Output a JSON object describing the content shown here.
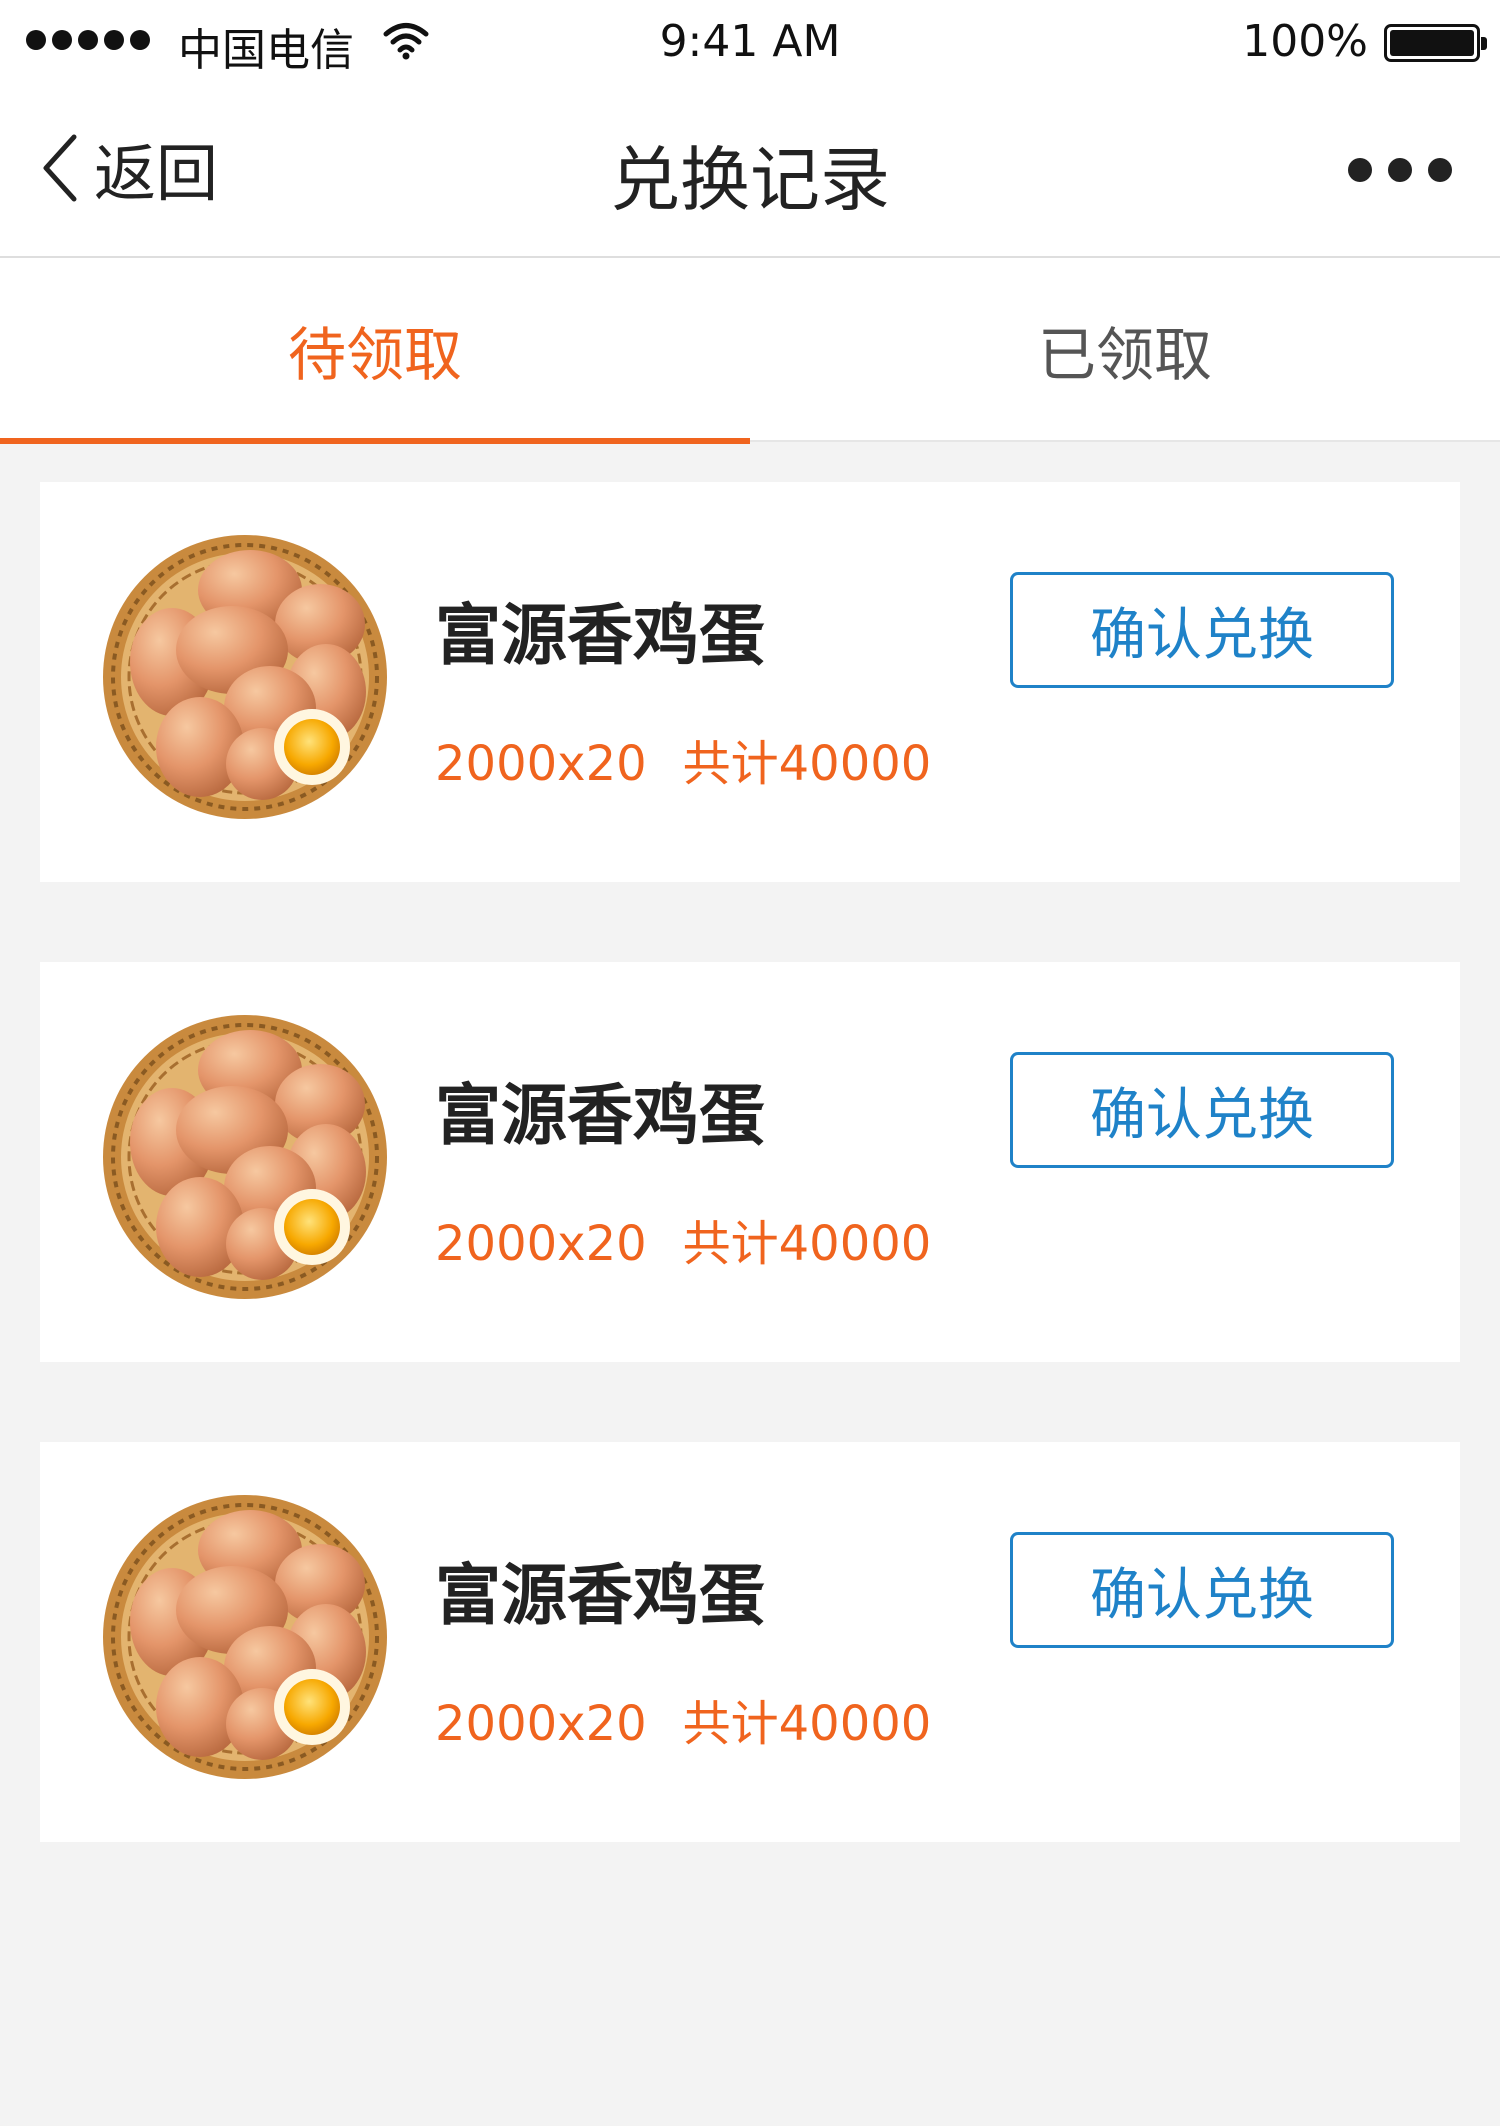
{
  "status_bar": {
    "carrier": "中国电信",
    "time": "9:41 AM",
    "battery": "100%"
  },
  "nav": {
    "back_label": "返回",
    "title": "兑换记录"
  },
  "tabs": [
    {
      "label": "待领取",
      "active": true
    },
    {
      "label": "已领取",
      "active": false
    }
  ],
  "items": [
    {
      "name": "富源香鸡蛋",
      "quantity": "2000x20",
      "total": "共计40000",
      "button": "确认兑换"
    },
    {
      "name": "富源香鸡蛋",
      "quantity": "2000x20",
      "total": "共计40000",
      "button": "确认兑换"
    },
    {
      "name": "富源香鸡蛋",
      "quantity": "2000x20",
      "total": "共计40000",
      "button": "确认兑换"
    }
  ],
  "colors": {
    "accent": "#f0641e",
    "button": "#1f82c8",
    "background": "#f3f3f3"
  },
  "icons": [
    "signal-dots-icon",
    "wifi-icon",
    "battery-icon",
    "back-chevron-icon",
    "more-icon",
    "egg-basket-image"
  ]
}
